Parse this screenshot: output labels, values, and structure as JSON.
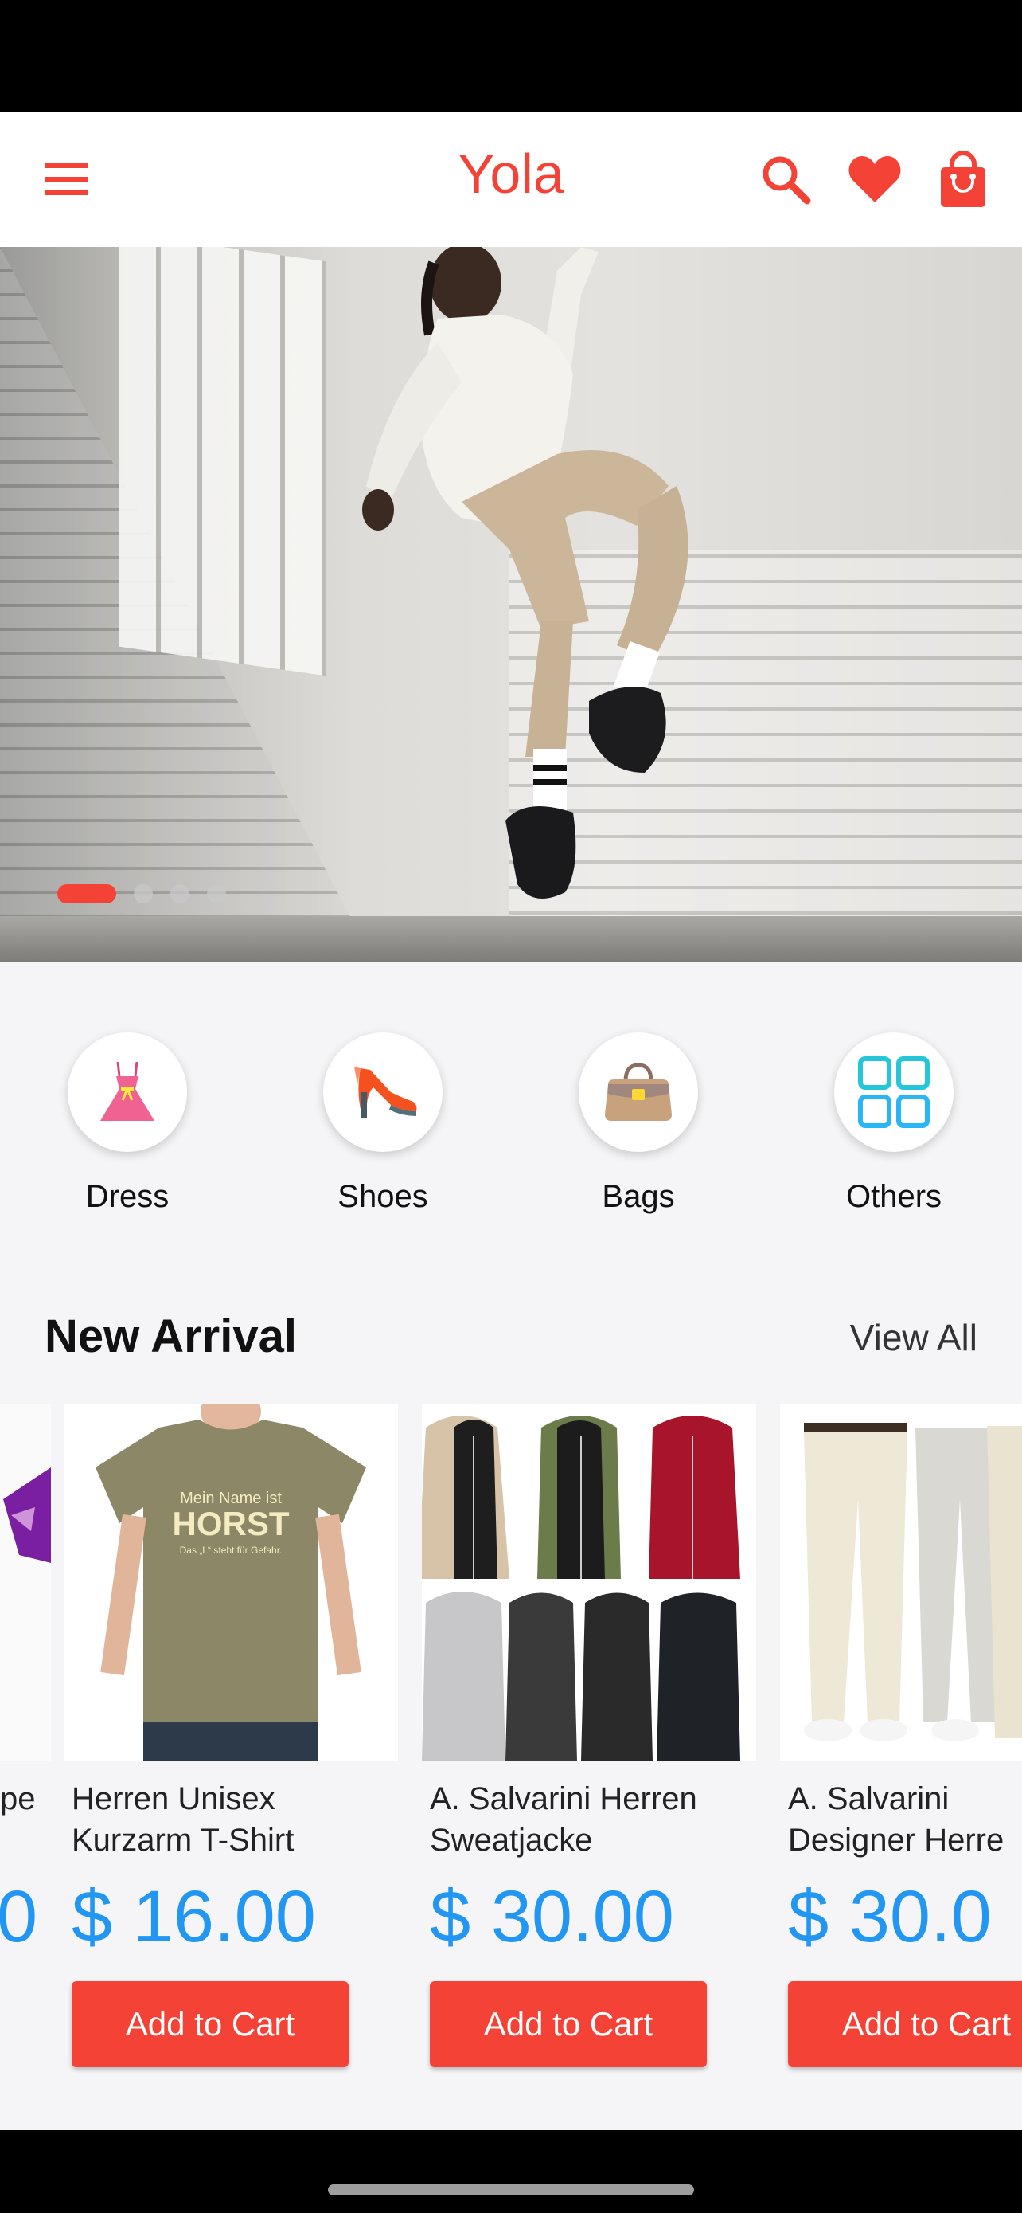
{
  "app_bar": {
    "title": "Yola",
    "icons": [
      "menu-icon",
      "search-icon",
      "heart-icon",
      "shopping-bag-icon"
    ],
    "accent_color": "#f44336"
  },
  "carousel": {
    "slide_count": 4,
    "active_index": 0
  },
  "categories": [
    {
      "label": "Dress",
      "icon": "dress-icon"
    },
    {
      "label": "Shoes",
      "icon": "high-heel-icon"
    },
    {
      "label": "Bags",
      "icon": "handbag-icon"
    },
    {
      "label": "Others",
      "icon": "grid-icon"
    }
  ],
  "new_arrival": {
    "title": "New Arrival",
    "view_all": "View All",
    "partial_left": {
      "name_fragment": "pe",
      "price_fragment": "0"
    },
    "products": [
      {
        "name": "Herren Unisex\nKurzarm T-Shirt",
        "price": "$ 16.00",
        "button": "Add to Cart",
        "shirt_text_1": "Mein Name ist",
        "shirt_text_2": "HORST",
        "shirt_text_3": "Das „L“ steht für Gefahr."
      },
      {
        "name": "A. Salvarini Herren\nSweatjacke",
        "price": "$ 30.00",
        "button": "Add to Cart"
      },
      {
        "name": "A. Salvarini\nDesigner Herre",
        "price": "$ 30.0",
        "button": "Add to Cart"
      }
    ]
  },
  "colors": {
    "price": "#2196f3",
    "button": "#f44336"
  }
}
